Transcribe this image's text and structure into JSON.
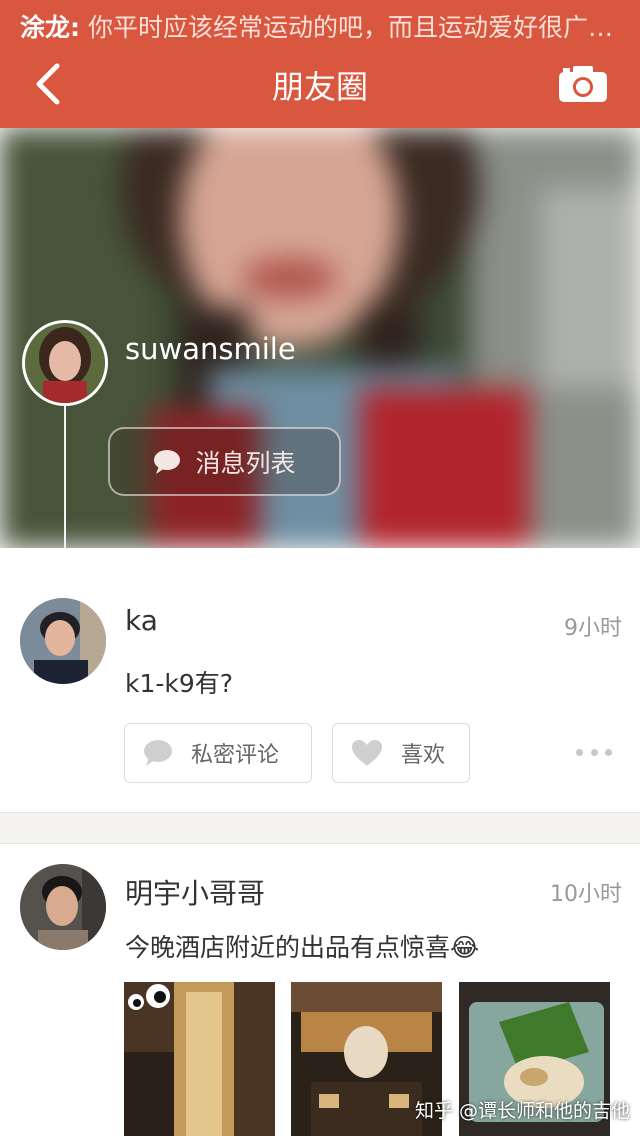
{
  "notification": {
    "sender": "涂龙:",
    "text": " 你平时应该经常运动的吧，而且运动爱好很广…"
  },
  "header": {
    "title": "朋友圈",
    "back_icon": "chevron-left-icon",
    "camera_icon": "camera-icon"
  },
  "profile": {
    "username": "suwansmile",
    "message_list_label": "消息列表"
  },
  "posts": [
    {
      "author": "ka",
      "time": "9小时",
      "text": "k1-k9有?",
      "actions": {
        "comment_label": "私密评论",
        "like_label": "喜欢"
      }
    },
    {
      "author": "明宇小哥哥",
      "time": "10小时",
      "text": "今晚酒店附近的出品有点惊喜😂",
      "photo_count": 3
    }
  ],
  "watermark": "知乎 @谭长师和他的吉他",
  "colors": {
    "accent": "#d9563f",
    "divider": "#f6f4f2"
  }
}
